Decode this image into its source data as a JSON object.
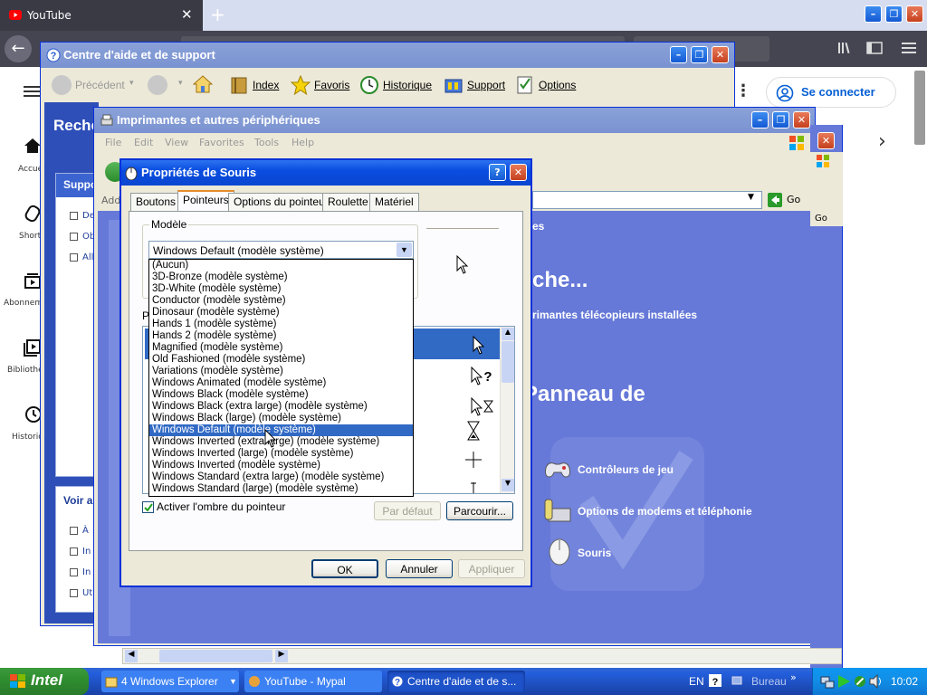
{
  "browser": {
    "tab_title": "YouTube",
    "new_tab": "+",
    "back": "←",
    "signin": "Se connecter",
    "min": "–",
    "restore": "❐",
    "close": "✕",
    "next_arrow": "›",
    "kebab": "⋮"
  },
  "yt_sidebar": {
    "items": [
      "Accueil",
      "Shorts",
      "Abonnements",
      "Bibliothèque",
      "Historique"
    ]
  },
  "help_center": {
    "title": "Centre d'aide et de support",
    "toolbar": {
      "back": "Précédent",
      "index": "Index",
      "favorites": "Favoris",
      "history": "Historique",
      "support": "Support",
      "options": "Options"
    },
    "search_partial": "Reche",
    "panel1_title": "Suppo",
    "panel1_items": [
      "De",
      "Ob",
      "All"
    ],
    "panel2_title": "Voir a",
    "panel2_items": [
      "À",
      "In",
      "In",
      "Ut"
    ]
  },
  "printers_window": {
    "title": "Imprimantes et autres périphériques",
    "menu": [
      "File",
      "Edit",
      "View",
      "Favorites",
      "Tools",
      "Help"
    ],
    "address_label": "Add",
    "go_label": "Go",
    "go_label2": "Go",
    "partial_es": "es",
    "heading_partial": "che...",
    "fax_text": "rimantes télécopieurs installées",
    "panel_heading": "Panneau de",
    "items": [
      "Contrôleurs de jeu",
      "Options de modems et téléphonie",
      "Souris"
    ]
  },
  "mouse_dialog": {
    "title": "Propriétés de Souris",
    "help_btn": "?",
    "tabs": [
      "Boutons",
      "Pointeurs",
      "Options du pointeur",
      "Roulette",
      "Matériel"
    ],
    "selected_tab": "Pointeurs",
    "group_label": "Modèle",
    "combo_value": "Windows Default (modèle système)",
    "partial_p": "P",
    "scheme_options": [
      "(Aucun)",
      "3D-Bronze (modèle système)",
      "3D-White (modèle système)",
      "Conductor (modèle système)",
      "Dinosaur (modèle système)",
      "Hands 1 (modèle système)",
      "Hands 2 (modèle système)",
      "Magnified (modèle système)",
      "Old Fashioned (modèle système)",
      "Variations (modèle système)",
      "Windows Animated (modèle système)",
      "Windows Black  (modèle système)",
      "Windows Black (extra large) (modèle système)",
      "Windows Black (large) (modèle système)",
      "Windows Default (modèle système)",
      "Windows Inverted (extra large) (modèle système)",
      "Windows Inverted (large) (modèle système)",
      "Windows Inverted (modèle système)",
      "Windows Standard (extra large) (modèle système)",
      "Windows Standard (large) (modèle système)"
    ],
    "highlighted_index": 14,
    "shadow_checkbox": "Activer l'ombre du pointeur",
    "shadow_checked": true,
    "btn_default": "Par défaut",
    "btn_browse": "Parcourir...",
    "btn_ok": "OK",
    "btn_cancel": "Annuler",
    "btn_apply": "Appliquer"
  },
  "taskbar": {
    "start": "Intel",
    "tasks": [
      "4 Windows Explorer",
      "YouTube - Mypal",
      "Centre d'aide et de s..."
    ],
    "lang": "EN",
    "desk": "Bureau",
    "chev": "»",
    "clock": "10:02"
  },
  "colors": {
    "xp_blue": "#0a4de0",
    "taskbar_blue": "#245edb",
    "start_green": "#2f8f2f",
    "control_panel_bg": "#6679d8",
    "selection": "#316ac5"
  }
}
